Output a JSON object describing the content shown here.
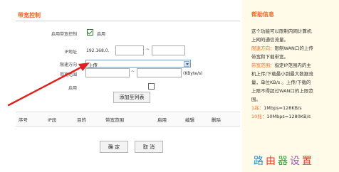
{
  "section_title": "带宽控制",
  "form": {
    "enable_label": "启用带宽控制",
    "enable_checkbox_text": "启用",
    "ip_label": "IP地址",
    "ip_prefix": "192.168.0.",
    "ip_separator": "~",
    "direction_label": "限速方向",
    "direction_value": "上传",
    "range_label": "带宽范围",
    "range_separator": "~",
    "range_unit": "(KByte/s)",
    "enable2_label": "启用",
    "add_button": "添加至列表"
  },
  "table": {
    "columns": [
      "序号",
      "IP段",
      "目的",
      "带宽范围",
      "启用",
      "编辑",
      "删除"
    ]
  },
  "buttons": {
    "ok": "确 定",
    "cancel": "取 消"
  },
  "help": {
    "title": "帮助信息",
    "line1": "这个功能可以限制内网计算机",
    "line2": "上网的通信流量。",
    "line3_label": "限速方向：",
    "line3_text": "限制WAN口的上传",
    "line4": "带宽和下载带宽。",
    "line5_label": "带宽范围：",
    "line5_text": "指定IP范围内的主",
    "line6": "机上传/下载最小到最大数据流",
    "line7": "量，单位KB/s 。上传/下载的",
    "line8": "上限不得超过WAN口的上限范",
    "line9": "围。",
    "line10_label": "1兆：",
    "line10_text": "1Mbps=128KB/s",
    "line11_label": "10兆：",
    "line11_text": "10Mbps=1280KB/s"
  },
  "watermark": {
    "chars": [
      "路",
      "由",
      "器",
      "设",
      "置"
    ],
    "colors": [
      "#1a8fd6",
      "#e6332a",
      "#2aa83a",
      "#9b59b6",
      "#e6332a"
    ]
  },
  "colors": {
    "accent": "#f26522",
    "arrow": "#e02020"
  }
}
